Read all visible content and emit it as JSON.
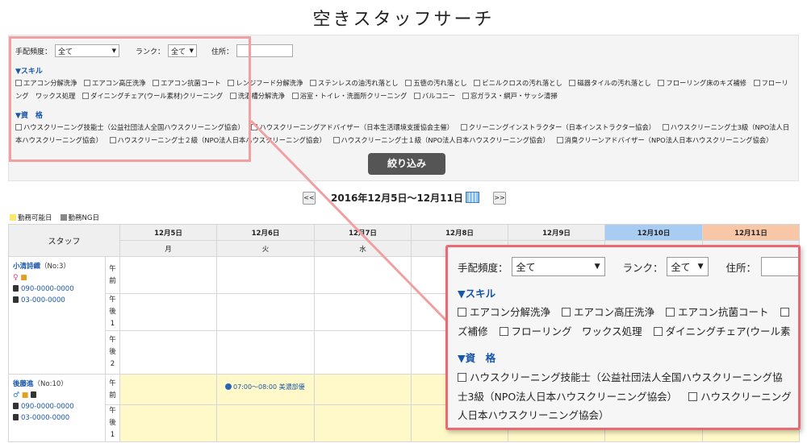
{
  "page": {
    "title": "空きスタッフサーチ"
  },
  "filters": {
    "frequency_label": "手配頻度：",
    "frequency_value": "全て",
    "rank_label": "ランク：",
    "rank_value": "全て",
    "address_label": "住所：",
    "skills_heading": "▼スキル",
    "skills": [
      "エアコン分解洗浄",
      "エアコン高圧洗浄",
      "エアコン抗菌コート",
      "レンジフード分解洗浄",
      "ステンレスの油汚れ落とし",
      "五徳の汚れ落とし",
      "ビニルクロスの汚れ落とし",
      "磁器タイルの汚れ落とし",
      "フローリング床のキズ補修",
      "フローリング　ワックス処理",
      "ダイニングチェア(ウール素材)クリーニング",
      "洗濯槽分解洗浄",
      "浴室・トイレ・洗面所クリーニング",
      "バルコニー",
      "窓ガラス・網戸・サッシ清掃"
    ],
    "quals_heading": "▼資　格",
    "quals": [
      "ハウスクリーニング技能士（公益社団法人全国ハウスクリーニング協会）",
      "ハウスクリーニングアドバイザー（日本生活環境支援協会主催）",
      "クリーニングインストラクター（日本インストラクター協会）",
      "ハウスクリーニング士3級（NPO法人日本ハウスクリーニング協会）",
      "ハウスクリーニング士２級（NPO法人日本ハウスクリーニング協会）",
      "ハウスクリーニング士１級（NPO法人日本ハウスクリーニング協会）",
      "消臭クリーンアドバイザー（NPO法人日本ハウスクリーニング協会）"
    ],
    "button_label": "絞り込み"
  },
  "week_nav": {
    "prev": "<<",
    "next": ">>",
    "label": "2016年12月5日～12月11日"
  },
  "legend": {
    "available": "勤務可能日",
    "ng": "勤務NG日"
  },
  "schedule": {
    "staff_header": "スタッフ",
    "days": [
      {
        "date": "12月5日",
        "dow": "月"
      },
      {
        "date": "12月6日",
        "dow": "火"
      },
      {
        "date": "12月7日",
        "dow": "水"
      },
      {
        "date": "12月8日",
        "dow": ""
      },
      {
        "date": "12月9日",
        "dow": ""
      },
      {
        "date": "12月10日",
        "dow": ""
      },
      {
        "date": "12月11日",
        "dow": ""
      }
    ],
    "slots": {
      "am": "午\n前",
      "pm1": "午\n後\n1",
      "pm2": "午\n後\n2"
    },
    "staff": [
      {
        "name": "小清詩織",
        "no": "（No:3）",
        "mobile": "090-0000-0000",
        "phone": "03-000-0000"
      },
      {
        "name": "後藤進",
        "no": "（No:10）",
        "mobile": "090-0000-0000",
        "phone": "03-0000-0000",
        "shift": "07:00～08:00 美濃部優"
      }
    ]
  },
  "zoom": {
    "line_skill_1": [
      "エアコン分解洗浄",
      "エアコン高圧洗浄",
      "エアコン抗菌コート"
    ],
    "line_skill_2a": "ズ補修",
    "line_skill_2b": "フローリング　ワックス処理",
    "line_skill_2c": "ダイニングチェア(ウール素",
    "line_qual_1": "ハウスクリーニング技能士（公益社団法人全国ハウスクリーニング協",
    "line_qual_2a": "士3級（NPO法人日本ハウスクリーニング協会）",
    "line_qual_2b": "ハウスクリーニング",
    "line_qual_3": "人日本ハウスクリーニング協会）"
  },
  "colors": {
    "accent": "#1a56a8",
    "highlight": "#e86a73",
    "available": "#ffe66d",
    "ng": "#888888",
    "saturday": "#a9cdf2",
    "sunday": "#f7c7a8"
  }
}
